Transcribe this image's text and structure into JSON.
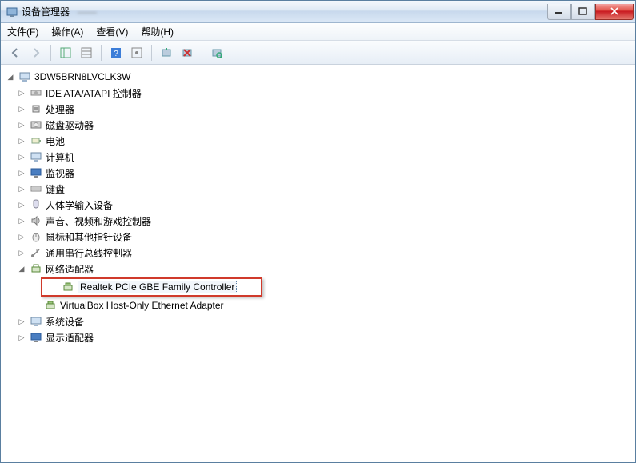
{
  "window": {
    "title": "设备管理器",
    "blurred_secondary": "——"
  },
  "menu": {
    "file": "文件(F)",
    "action": "操作(A)",
    "view": "查看(V)",
    "help": "帮助(H)"
  },
  "tree": {
    "root": "3DW5BRN8LVCLK3W",
    "nodes": [
      {
        "id": "ide",
        "label": "IDE ATA/ATAPI 控制器",
        "expandable": true
      },
      {
        "id": "cpu",
        "label": "处理器",
        "expandable": true
      },
      {
        "id": "disk",
        "label": "磁盘驱动器",
        "expandable": true
      },
      {
        "id": "battery",
        "label": "电池",
        "expandable": true
      },
      {
        "id": "computer",
        "label": "计算机",
        "expandable": true
      },
      {
        "id": "monitor",
        "label": "监视器",
        "expandable": true
      },
      {
        "id": "keyboard",
        "label": "键盘",
        "expandable": true
      },
      {
        "id": "hid",
        "label": "人体学输入设备",
        "expandable": true
      },
      {
        "id": "sound",
        "label": "声音、视频和游戏控制器",
        "expandable": true
      },
      {
        "id": "mouse",
        "label": "鼠标和其他指针设备",
        "expandable": true
      },
      {
        "id": "usb",
        "label": "通用串行总线控制器",
        "expandable": true
      },
      {
        "id": "network",
        "label": "网络适配器",
        "expandable": true,
        "expanded": true,
        "children": [
          {
            "id": "realtek",
            "label": "Realtek PCIe GBE Family Controller",
            "selected": true,
            "highlighted": true
          },
          {
            "id": "vbox",
            "label": "VirtualBox Host-Only Ethernet Adapter"
          }
        ]
      },
      {
        "id": "system",
        "label": "系统设备",
        "expandable": true
      },
      {
        "id": "display",
        "label": "显示适配器",
        "expandable": true
      }
    ]
  }
}
